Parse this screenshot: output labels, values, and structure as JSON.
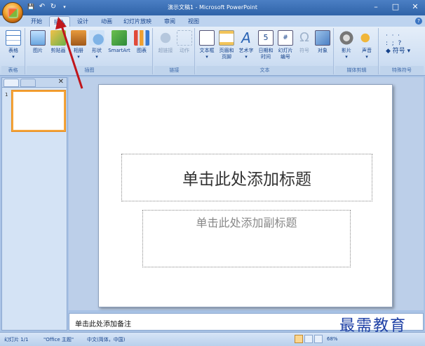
{
  "window": {
    "title": "演示文稿1 - Microsoft PowerPoint"
  },
  "quick_access": {
    "save": "💾",
    "undo": "↶",
    "redo": "↻",
    "more": "▾"
  },
  "tabs": [
    {
      "label": "开始"
    },
    {
      "label": "插入"
    },
    {
      "label": "设计"
    },
    {
      "label": "动画"
    },
    {
      "label": "幻灯片放映"
    },
    {
      "label": "审阅"
    },
    {
      "label": "视图"
    }
  ],
  "ribbon": {
    "groups": [
      {
        "label": "表格",
        "buttons": [
          {
            "label": "表格",
            "sub": "▾",
            "icon": "table-icon"
          }
        ]
      },
      {
        "label": "插图",
        "buttons": [
          {
            "label": "图片",
            "icon": "picture-icon"
          },
          {
            "label": "剪贴画",
            "icon": "clipart-icon"
          },
          {
            "label": "相册",
            "sub": "▾",
            "icon": "album-icon"
          },
          {
            "label": "形状",
            "sub": "▾",
            "icon": "shapes-icon"
          },
          {
            "label": "SmartArt",
            "icon": "smartart-icon"
          },
          {
            "label": "图表",
            "icon": "chart-icon"
          }
        ]
      },
      {
        "label": "链接",
        "buttons": [
          {
            "label": "超链接",
            "icon": "hyperlink-icon"
          },
          {
            "label": "动作",
            "icon": "action-icon"
          }
        ]
      },
      {
        "label": "文本",
        "buttons": [
          {
            "label": "文本框",
            "sub": "▾",
            "icon": "textbox-icon"
          },
          {
            "label": "页眉和",
            "sub": "页脚",
            "icon": "header-footer-icon"
          },
          {
            "label": "艺术字",
            "sub": "▾",
            "icon": "wordart-icon"
          },
          {
            "label": "日期和",
            "sub": "时间",
            "icon": "datetime-icon"
          },
          {
            "label": "幻灯片",
            "sub": "编号",
            "icon": "slide-number-icon"
          },
          {
            "label": "符号",
            "icon": "symbol-icon"
          },
          {
            "label": "对象",
            "icon": "object-icon"
          }
        ]
      },
      {
        "label": "媒体剪辑",
        "buttons": [
          {
            "label": "影片",
            "sub": "▾",
            "icon": "movie-icon"
          },
          {
            "label": "声音",
            "sub": "▾",
            "icon": "sound-icon"
          }
        ]
      },
      {
        "label": "特殊符号",
        "buttons": [
          {
            "label": "符号",
            "icon": "special-symbol-icon"
          }
        ]
      }
    ]
  },
  "slide": {
    "title_placeholder": "单击此处添加标题",
    "subtitle_placeholder": "单击此处添加副标题"
  },
  "panel": {
    "slide_number": "1"
  },
  "notes": {
    "placeholder": "单击此处添加备注"
  },
  "status": {
    "slide": "幻灯片 1/1",
    "theme": "\"Office 主题\"",
    "language": "中文(简体，中国)",
    "zoom": "68%"
  },
  "watermark": "最需教育",
  "colors": {
    "accent": "#2f63a8",
    "ribbon": "#cfdff3",
    "active_thumb": "#f5a53b",
    "arrow": "#c0161b"
  }
}
